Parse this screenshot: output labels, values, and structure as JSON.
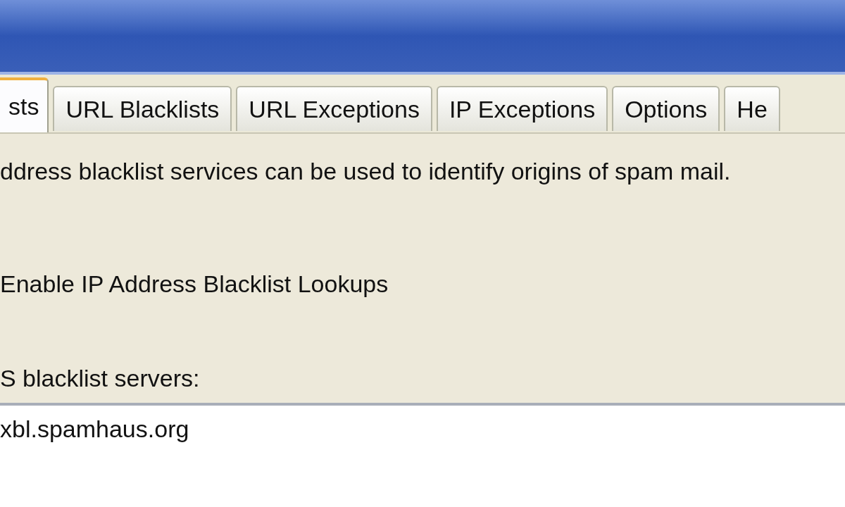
{
  "tabs": [
    {
      "label": "sts",
      "selected": true
    },
    {
      "label": "URL Blacklists",
      "selected": false
    },
    {
      "label": "URL Exceptions",
      "selected": false
    },
    {
      "label": "IP Exceptions",
      "selected": false
    },
    {
      "label": "Options",
      "selected": false
    },
    {
      "label": "He",
      "selected": false
    }
  ],
  "description": "ddress blacklist services can be used to identify origins of spam mail.",
  "enable_option": {
    "label": "Enable IP Address Blacklist Lookups"
  },
  "servers": {
    "label": "S blacklist servers:",
    "items": [
      "xbl.spamhaus.org"
    ]
  }
}
